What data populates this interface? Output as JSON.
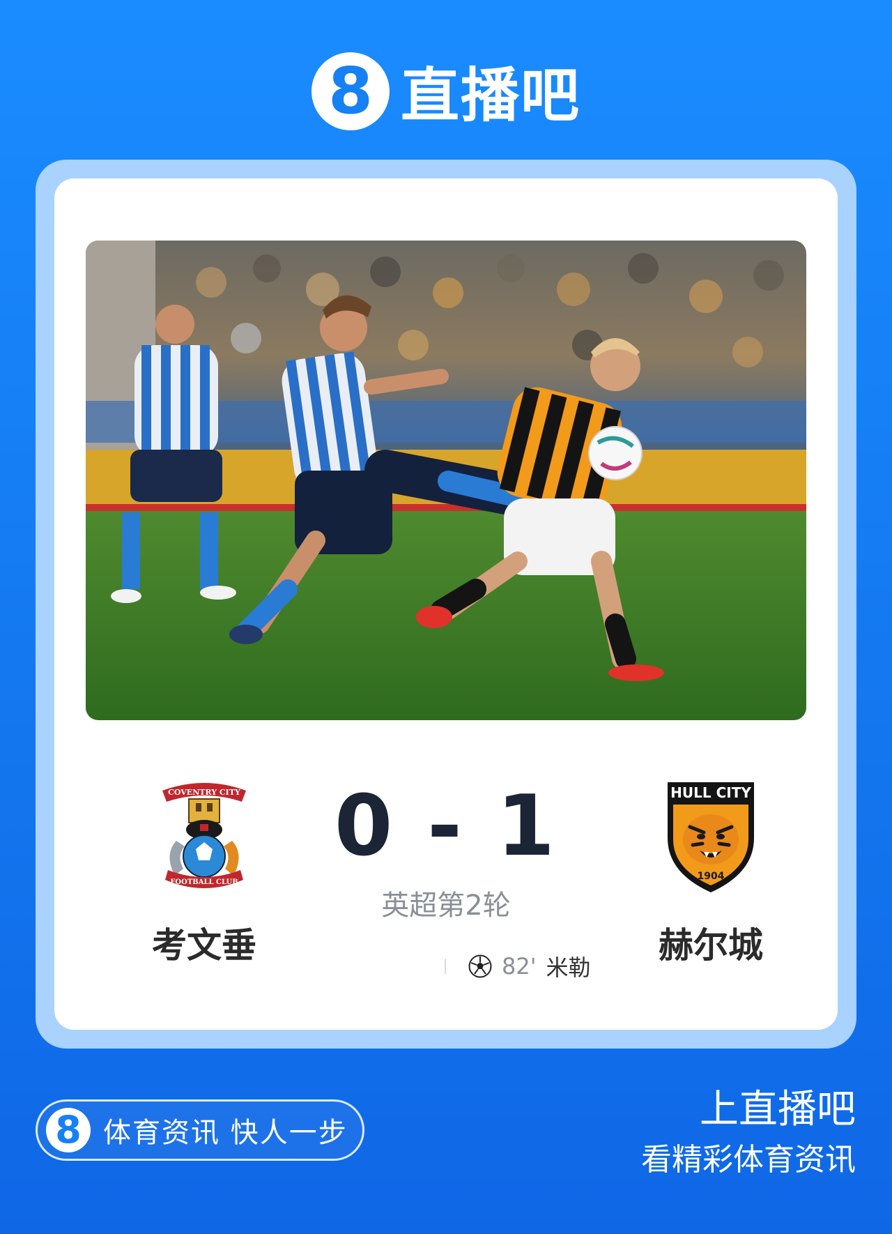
{
  "brand": {
    "mark": "8",
    "name": "直播吧"
  },
  "match": {
    "home": {
      "name": "考文垂",
      "crest_top": "COVENTRY CITY",
      "crest_bottom": "FOOTBALL CLUB",
      "crest_icon": "coventry-crest-icon"
    },
    "away": {
      "name": "赫尔城",
      "crest_top": "HULL CITY",
      "crest_year": "1904",
      "crest_icon": "hull-city-tiger-crest-icon"
    },
    "score": "0 - 1",
    "competition_round": "英超第2轮",
    "events": [
      {
        "icon": "soccer-ball-icon",
        "minute": "82'",
        "player": "米勒"
      }
    ]
  },
  "footer": {
    "pill_mark": "8",
    "slogan": "体育资讯 快人一步",
    "cta_title": "上直播吧",
    "cta_subtitle": "看精彩体育资讯"
  },
  "colors": {
    "background": "#1680f5",
    "card_frame": "#a9d2ff",
    "score_text": "#1b2535",
    "round_text": "#8a8f98",
    "hull_amber": "#f29a1a",
    "coventry_sky": "#2a8ad8"
  }
}
